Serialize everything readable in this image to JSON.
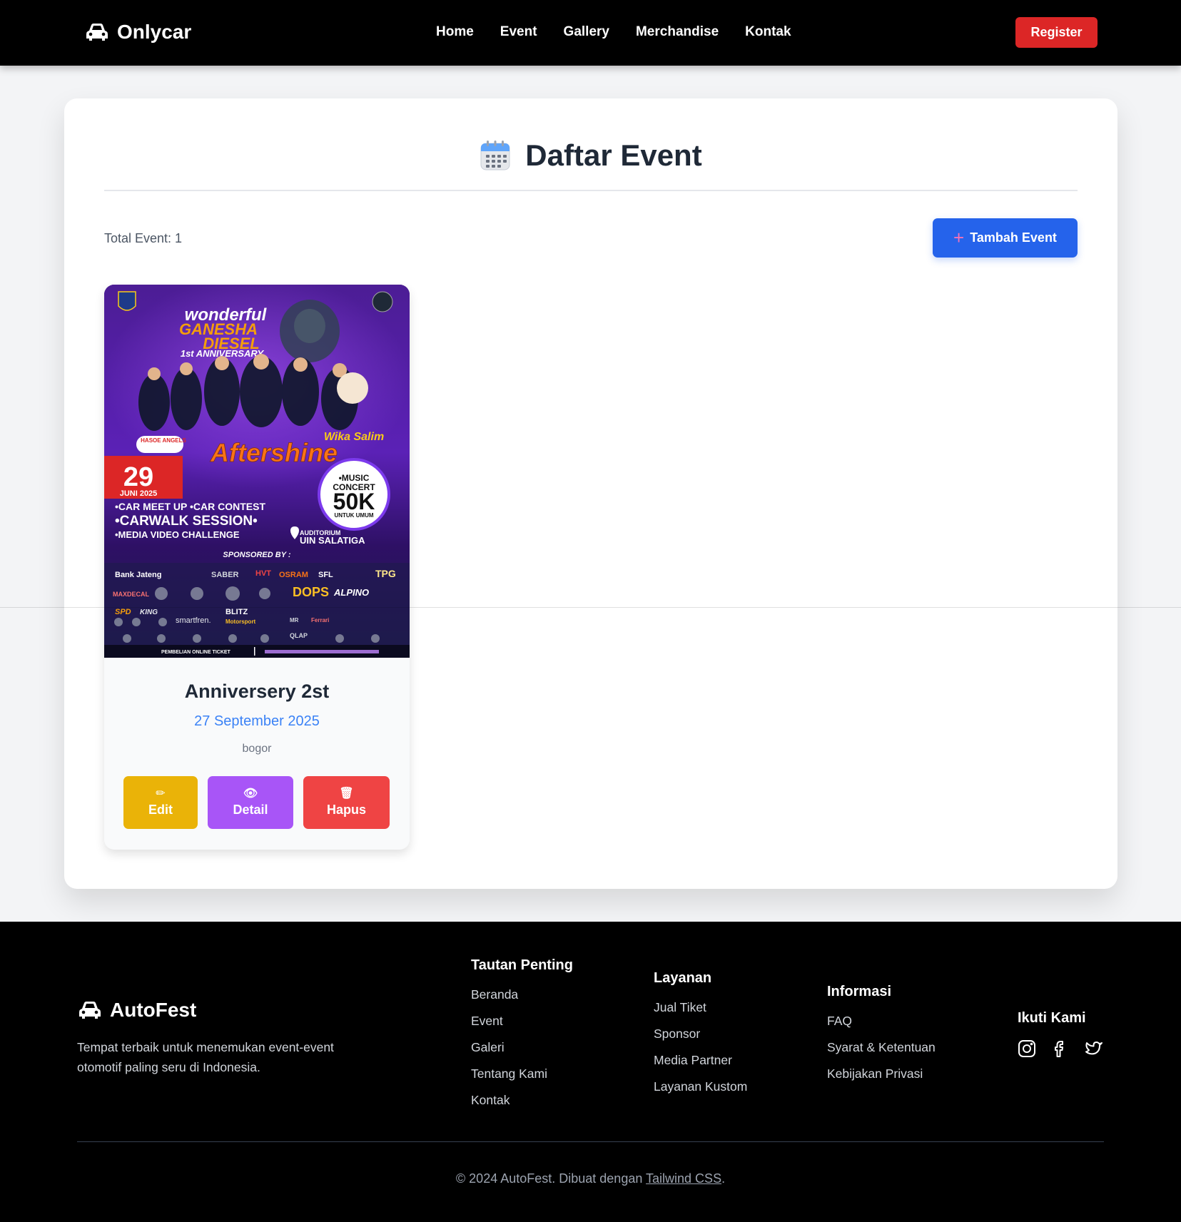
{
  "navbar": {
    "brand": "Onlycar",
    "links": [
      "Home",
      "Event",
      "Gallery",
      "Merchandise",
      "Kontak"
    ],
    "register_label": "Register"
  },
  "main": {
    "title": "Daftar Event",
    "total_label": "Total Event: 1",
    "add_label": "Tambah Event"
  },
  "event": {
    "title": "Anniversery 2st",
    "date": "27 September 2025",
    "location": "bogor",
    "actions": {
      "edit": "Edit",
      "detail": "Detail",
      "delete": "Hapus"
    },
    "poster": {
      "headline_1": "wonderful",
      "headline_2": "GANESHA",
      "headline_3": "DIESEL",
      "headline_4": "1st ANNIVERSARY",
      "guest": "Aftershine",
      "guest_2": "Wika Salim",
      "badge": "HASOE ANGELS",
      "day": "29",
      "month": "JUNI 2025",
      "concert_1": "•MUSIC",
      "concert_2": "CONCERT",
      "concert_price": "50K",
      "concert_note": "UNTUK UMUM",
      "activity_1": "•CAR MEET UP •CAR CONTEST",
      "activity_2": "•CARWALK SESSION•",
      "activity_3": "•MEDIA VIDEO CHALLENGE",
      "venue_1": "AUDITORIUM",
      "venue_2": "UIN SALATIGA",
      "sponsor_label": "SPONSORED BY :",
      "sponsors": [
        "Bank Jateng",
        "SABER",
        "HVT",
        "OSRAM",
        "SFL",
        "TPG",
        "MAXDECAL",
        "DOPS",
        "ALPINO",
        "SPD",
        "KING",
        "BLITZ",
        "smartfren.",
        "Motorsport",
        "MR",
        "Ferrari",
        "QLAP"
      ],
      "ticket_note": "PEMBELIAN ONLINE TICKET"
    }
  },
  "footer": {
    "brand": "AutoFest",
    "description": "Tempat terbaik untuk menemukan event-event otomotif paling seru di Indonesia.",
    "columns": [
      {
        "title": "Tautan Penting",
        "items": [
          "Beranda",
          "Event",
          "Galeri",
          "Tentang Kami",
          "Kontak"
        ]
      },
      {
        "title": "Layanan",
        "items": [
          "Jual Tiket",
          "Sponsor",
          "Media Partner",
          "Layanan Kustom"
        ]
      },
      {
        "title": "Informasi",
        "items": [
          "FAQ",
          "Syarat & Ketentuan",
          "Kebijakan Privasi"
        ]
      }
    ],
    "follow_title": "Ikuti Kami",
    "socials": [
      "instagram-icon",
      "facebook-icon",
      "twitter-icon"
    ],
    "copyright_prefix": "© 2024 AutoFest. Dibuat dengan ",
    "copyright_link": "Tailwind CSS",
    "copyright_suffix": "."
  },
  "colors": {
    "navbar_bg": "#000000",
    "register": "#dc2626",
    "add_button": "#2563eb",
    "date_blue": "#3b82f6",
    "edit": "#eab308",
    "detail": "#a855f7",
    "delete": "#ef4444"
  }
}
